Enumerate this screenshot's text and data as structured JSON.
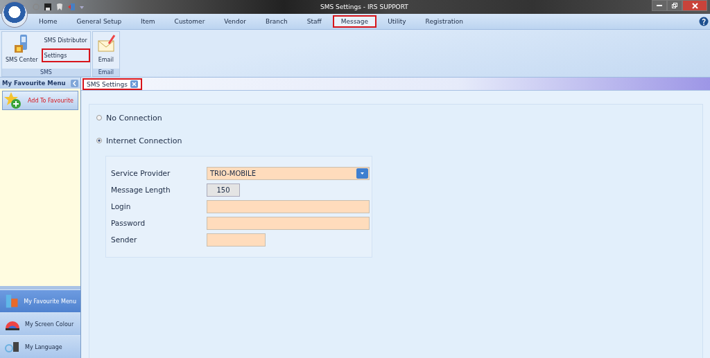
{
  "window": {
    "title": "SMS Settings - IRS SUPPORT"
  },
  "menu_tabs": [
    {
      "label": "Home",
      "selected": false,
      "highlighted": false
    },
    {
      "label": "General Setup",
      "selected": false,
      "highlighted": false
    },
    {
      "label": "Item",
      "selected": false,
      "highlighted": false
    },
    {
      "label": "Customer",
      "selected": false,
      "highlighted": false
    },
    {
      "label": "Vendor",
      "selected": false,
      "highlighted": false
    },
    {
      "label": "Branch",
      "selected": false,
      "highlighted": false
    },
    {
      "label": "Staff",
      "selected": false,
      "highlighted": false
    },
    {
      "label": "Message",
      "selected": true,
      "highlighted": true
    },
    {
      "label": "Utility",
      "selected": false,
      "highlighted": false
    },
    {
      "label": "Registration",
      "selected": false,
      "highlighted": false
    }
  ],
  "ribbon_groups": [
    {
      "label": "SMS",
      "items": [
        {
          "label": "SMS Center",
          "kind": "large",
          "highlighted": false
        },
        {
          "label": "SMS Distributor",
          "kind": "small",
          "highlighted": false
        },
        {
          "label": "Settings",
          "kind": "small",
          "highlighted": true
        }
      ]
    },
    {
      "label": "Email",
      "items": [
        {
          "label": "Email",
          "kind": "large",
          "highlighted": false
        }
      ]
    }
  ],
  "sidebar": {
    "title": "My Favourite Menu",
    "add_button": "Add To Favourite",
    "nav": [
      {
        "label": "My Favourite Menu",
        "selected": true
      },
      {
        "label": "My Screen Colour",
        "selected": false
      },
      {
        "label": "My Language",
        "selected": false
      }
    ]
  },
  "document_tabs": [
    {
      "label": "SMS Settings",
      "selected": true,
      "highlighted": true
    }
  ],
  "connection": [
    {
      "label": "No Connection",
      "selected": false
    },
    {
      "label": "Internet Connection",
      "selected": true
    }
  ],
  "form": [
    {
      "label": "Service Provider",
      "kind": "dropdown",
      "value": "TRIO-MOBILE"
    },
    {
      "label": "Message Length",
      "kind": "readonly",
      "value": "150"
    },
    {
      "label": "Login",
      "kind": "text"
    },
    {
      "label": "Password",
      "kind": "text"
    },
    {
      "label": "Sender",
      "kind": "text"
    }
  ]
}
